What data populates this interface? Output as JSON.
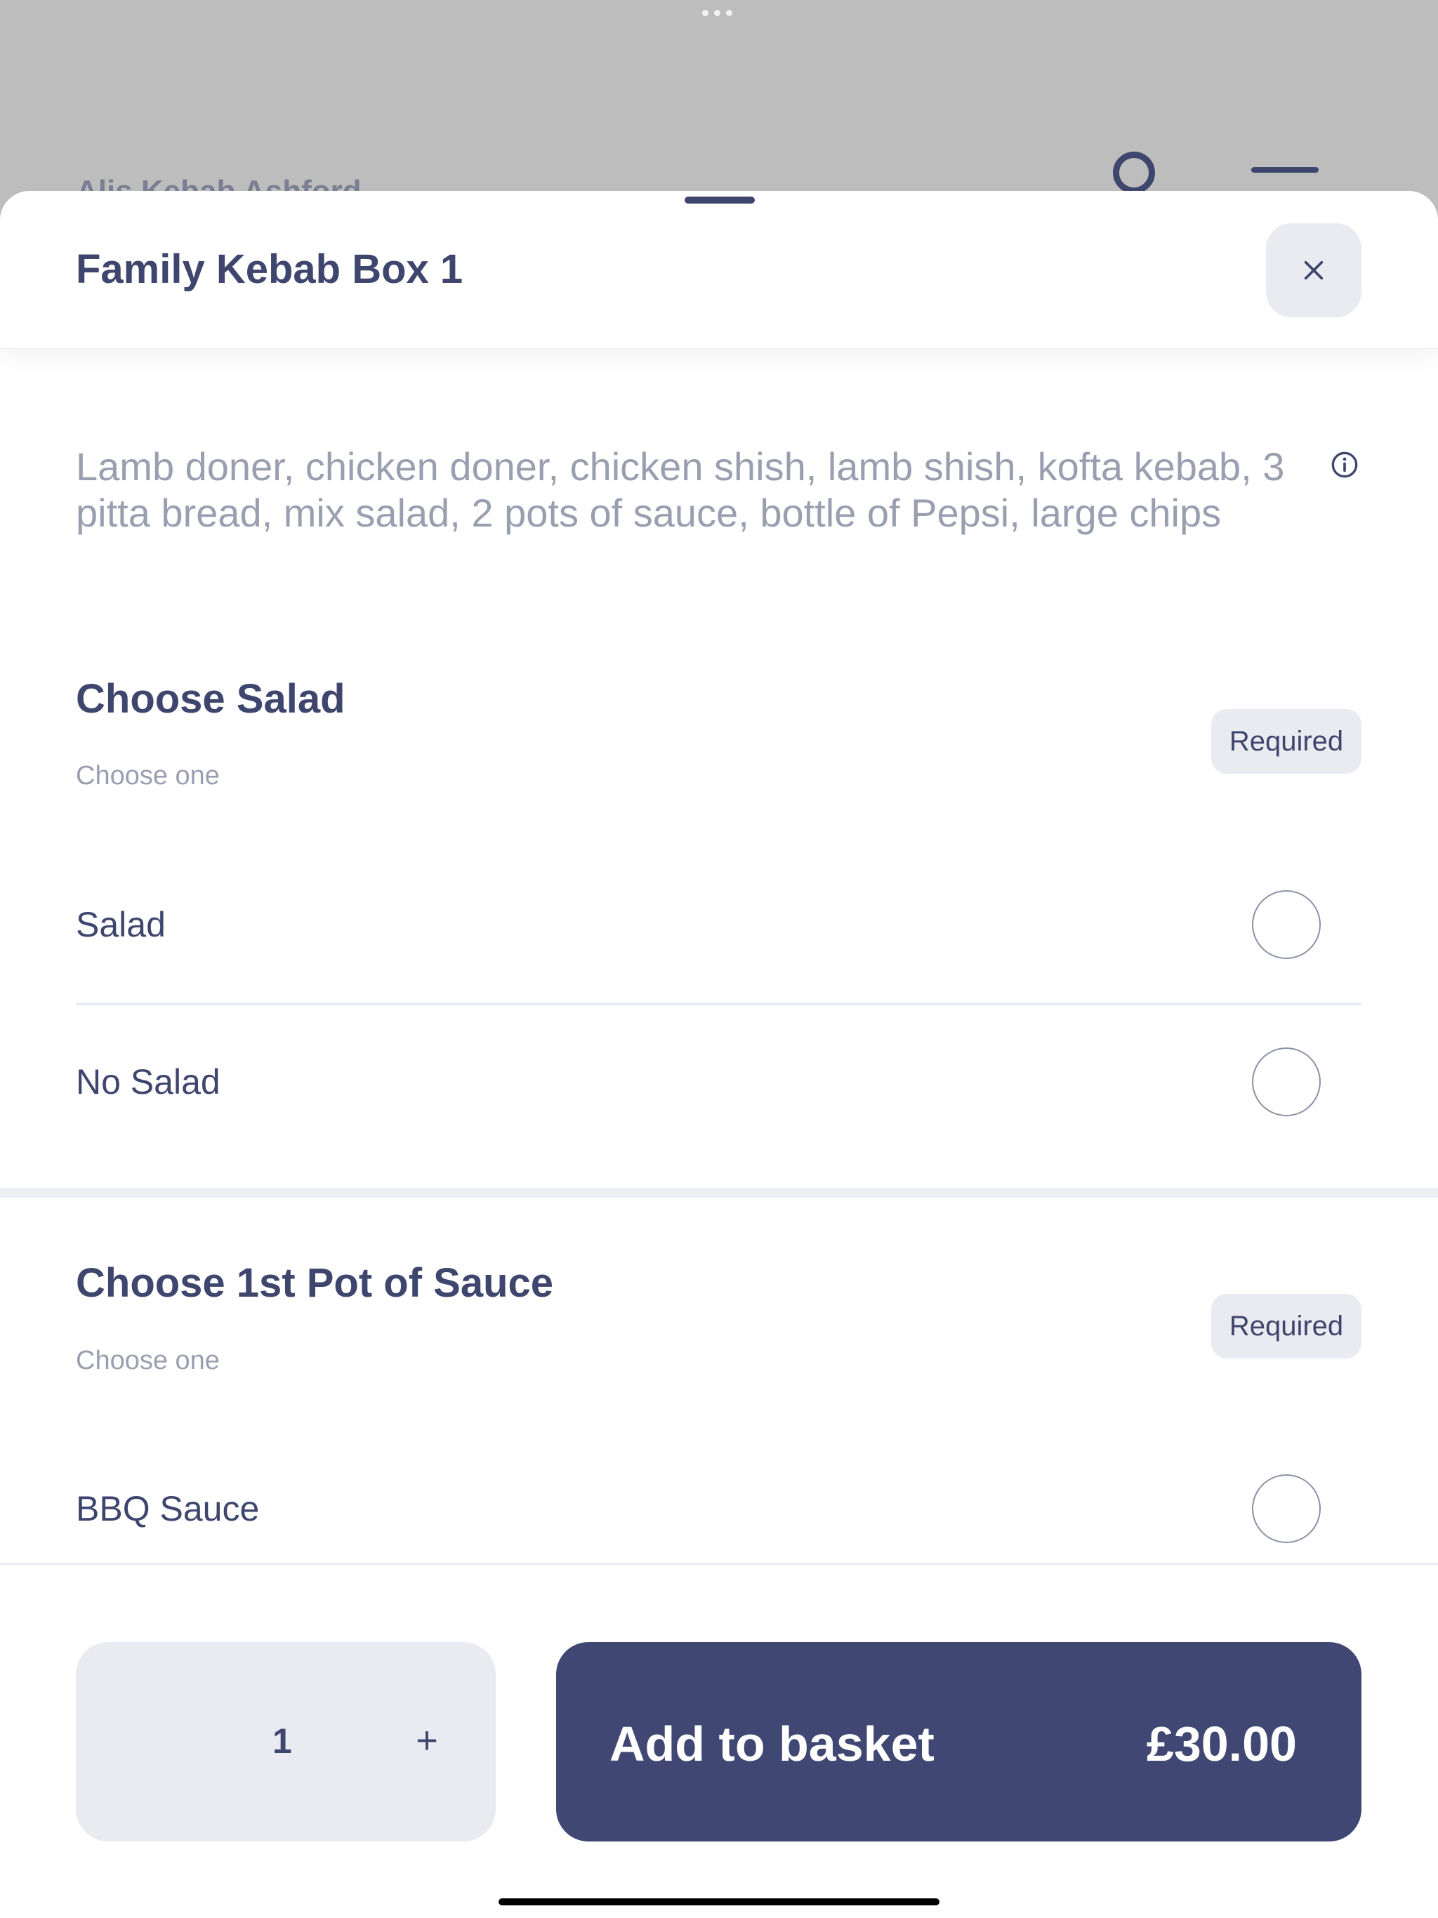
{
  "background": {
    "restaurant_name": "Alis Kebab Ashford"
  },
  "modal": {
    "title": "Family Kebab Box 1",
    "description": "Lamb doner, chicken doner, chicken shish, lamb shish, kofta kebab, 3 pitta bread, mix salad, 2 pots of sauce, bottle of Pepsi, large chips",
    "sections": [
      {
        "title": "Choose Salad",
        "subtitle": "Choose one",
        "badge": "Required",
        "options": [
          "Salad",
          "No Salad"
        ]
      },
      {
        "title": "Choose 1st Pot of Sauce",
        "subtitle": "Choose one",
        "badge": "Required",
        "options": [
          "BBQ Sauce"
        ]
      }
    ]
  },
  "footer": {
    "quantity": "1",
    "plus": "+",
    "add_label": "Add to basket",
    "price": "£30.00"
  },
  "icons": {
    "close": "close-icon",
    "info": "info-icon",
    "user": "user-icon",
    "menu": "menu-icon"
  },
  "colors": {
    "primary": "#3f4772",
    "muted_text": "#9a9fb0",
    "chip_bg": "#eaebf0",
    "overlay": "#bdbdbd"
  }
}
